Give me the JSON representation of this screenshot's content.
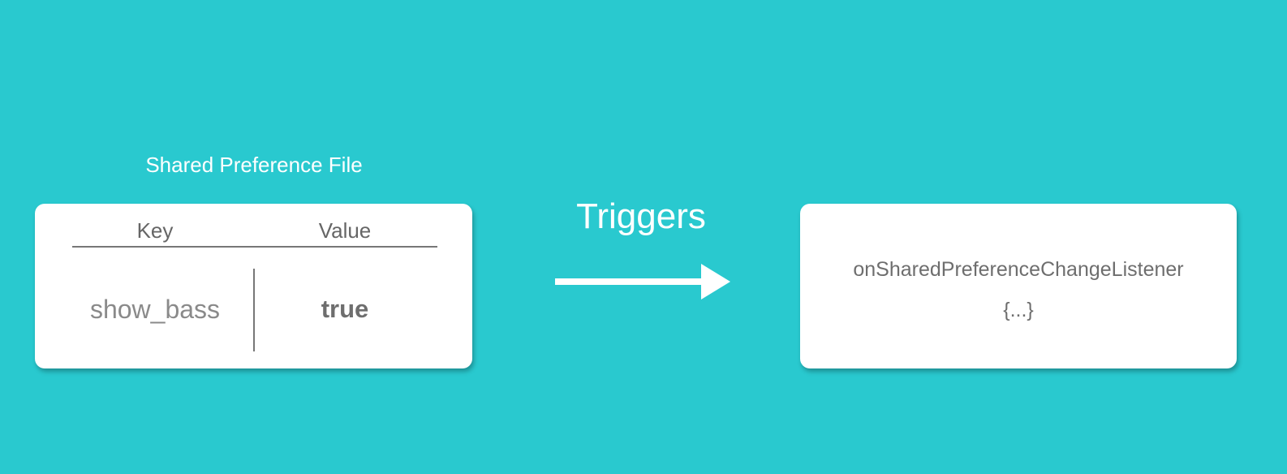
{
  "colors": {
    "background": "#29C9CF",
    "card": "#FFFFFF",
    "text_dark": "#6E6E6E",
    "text_light": "#FFFFFF"
  },
  "preference_file": {
    "title": "Shared Preference File",
    "headers": {
      "key": "Key",
      "value": "Value"
    },
    "rows": [
      {
        "key": "show_bass",
        "value": "true"
      }
    ]
  },
  "connector": {
    "label": "Triggers"
  },
  "listener": {
    "name": "onSharedPreferenceChangeListener",
    "body": "{...}"
  }
}
